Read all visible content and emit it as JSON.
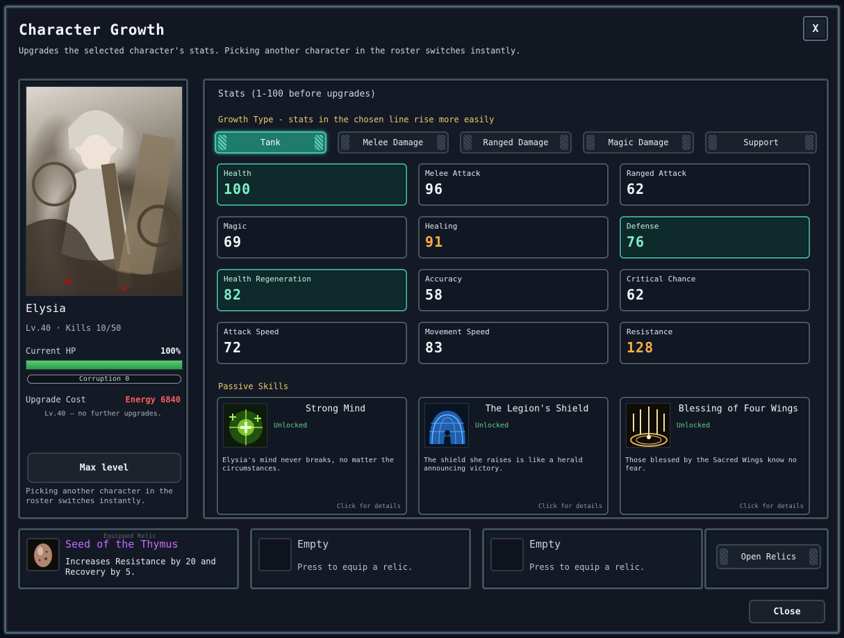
{
  "window": {
    "title": "Character Growth",
    "subtitle": "Upgrades the selected character's stats. Picking another character in the roster switches instantly.",
    "close_x": "X",
    "close_label": "Close"
  },
  "character": {
    "name": "Elysia",
    "level_line": "Lv.40 · Kills 10/50",
    "hp_label": "Current HP",
    "hp_value": "100%",
    "hp_fraction": 1.0,
    "corruption": "Corruption 0",
    "cost_label": "Upgrade Cost",
    "cost_value": "Energy 6840",
    "cost_note": "Lv.40 — no further upgrades.",
    "max_button": "Max level",
    "note": "Picking another character in the roster switches instantly."
  },
  "stats": {
    "title": "Stats (1-100 before upgrades)",
    "growth_label": "Growth Type  -  stats in the chosen line rise more easily",
    "growth_types": [
      "Tank",
      "Melee Damage",
      "Ranged Damage",
      "Magic Damage",
      "Support"
    ],
    "active_growth": "Tank",
    "items": [
      {
        "name": "Health",
        "value": "100"
      },
      {
        "name": "Melee Attack",
        "value": "96"
      },
      {
        "name": "Ranged Attack",
        "value": "62"
      },
      {
        "name": "Magic",
        "value": "69"
      },
      {
        "name": "Healing",
        "value": "91"
      },
      {
        "name": "Defense",
        "value": "76"
      },
      {
        "name": "Health Regeneration",
        "value": "82"
      },
      {
        "name": "Accuracy",
        "value": "58"
      },
      {
        "name": "Critical Chance",
        "value": "62"
      },
      {
        "name": "Attack Speed",
        "value": "72"
      },
      {
        "name": "Movement Speed",
        "value": "83"
      },
      {
        "name": "Resistance",
        "value": "128"
      }
    ],
    "colors": {
      "highlight": "#3aa893",
      "green_value": "#7ff0c8",
      "orange_value": "#ffad45"
    }
  },
  "passives": {
    "label": "Passive Skills",
    "items": [
      {
        "name": "Strong Mind",
        "state": "Unlocked",
        "desc": "Elysia's mind never breaks, no matter the circumstances.",
        "link": "Click for details",
        "icon": "strong-mind-icon"
      },
      {
        "name": "The Legion's Shield",
        "state": "Unlocked",
        "desc": "The shield she raises is like a herald announcing victory.",
        "link": "Click for details",
        "icon": "legion-shield-icon"
      },
      {
        "name": "Blessing of Four Wings",
        "state": "Unlocked",
        "desc": "Those blessed by the Sacred Wings know no fear.",
        "link": "Click for details",
        "icon": "four-wings-icon"
      }
    ]
  },
  "relics": {
    "slots": [
      {
        "name": "Seed of the Thymus",
        "desc": "Increases Resistance by 20 and Recovery by 5.",
        "ghost": "Equipped Relic",
        "icon": "seed-egg-icon"
      },
      {
        "name": "Empty",
        "desc": "Press to equip a relic."
      },
      {
        "name": "Empty",
        "desc": "Press to equip a relic."
      }
    ],
    "open_label": "Open Relics"
  }
}
